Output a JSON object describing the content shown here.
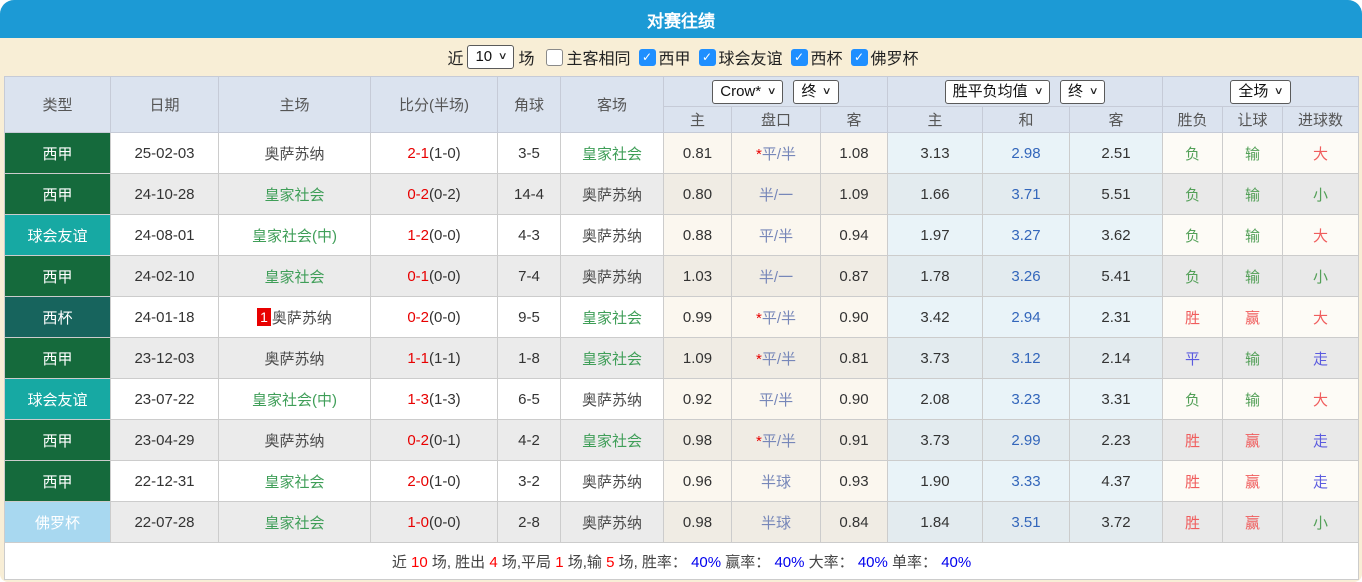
{
  "title": "对赛往绩",
  "filters": {
    "near_label": "近",
    "near_value": "10",
    "games_label": "场",
    "same_venue": {
      "label": "主客相同",
      "checked": false
    },
    "leagues": [
      {
        "label": "西甲",
        "checked": true
      },
      {
        "label": "球会友谊",
        "checked": true
      },
      {
        "label": "西杯",
        "checked": true
      },
      {
        "label": "佛罗杯",
        "checked": true
      }
    ]
  },
  "table": {
    "controls": {
      "odds_company": "Crow*",
      "odds_time": "终",
      "avg_label": "胜平负均值",
      "avg_time": "终",
      "scope": "全场"
    },
    "headers": {
      "type": "类型",
      "date": "日期",
      "home": "主场",
      "score": "比分(半场)",
      "corner": "角球",
      "away": "客场",
      "odds_home": "主",
      "odds_handicap": "盘口",
      "odds_away": "客",
      "avg_home": "主",
      "avg_draw": "和",
      "avg_away": "客",
      "result_wdl": "胜负",
      "result_handicap": "让球",
      "result_goals": "进球数"
    },
    "rows": [
      {
        "type": "西甲",
        "type_key": "liga",
        "date": "25-02-03",
        "home": "奥萨苏纳",
        "home_hl": false,
        "badge": "",
        "score_ft": "2-1",
        "score_ht": "(1-0)",
        "corner": "3-5",
        "away": "皇家社会",
        "away_hl": true,
        "o_home": "0.81",
        "h_star": "*",
        "handicap": "平/半",
        "o_away": "1.08",
        "a_home": "3.13",
        "a_draw": "2.98",
        "a_away": "2.51",
        "r1": "负",
        "r1c": "green",
        "r2": "输",
        "r2c": "green",
        "r3": "大",
        "r3c": "red"
      },
      {
        "type": "西甲",
        "type_key": "liga",
        "date": "24-10-28",
        "home": "皇家社会",
        "home_hl": true,
        "badge": "",
        "score_ft": "0-2",
        "score_ht": "(0-2)",
        "corner": "14-4",
        "away": "奥萨苏纳",
        "away_hl": false,
        "o_home": "0.80",
        "h_star": "",
        "handicap": "半/一",
        "o_away": "1.09",
        "a_home": "1.66",
        "a_draw": "3.71",
        "a_away": "5.51",
        "r1": "负",
        "r1c": "green",
        "r2": "输",
        "r2c": "green",
        "r3": "小",
        "r3c": "green"
      },
      {
        "type": "球会友谊",
        "type_key": "friendly",
        "date": "24-08-01",
        "home": "皇家社会(中)",
        "home_hl": true,
        "badge": "",
        "score_ft": "1-2",
        "score_ht": "(0-0)",
        "corner": "4-3",
        "away": "奥萨苏纳",
        "away_hl": false,
        "o_home": "0.88",
        "h_star": "",
        "handicap": "平/半",
        "o_away": "0.94",
        "a_home": "1.97",
        "a_draw": "3.27",
        "a_away": "3.62",
        "r1": "负",
        "r1c": "green",
        "r2": "输",
        "r2c": "green",
        "r3": "大",
        "r3c": "red"
      },
      {
        "type": "西甲",
        "type_key": "liga",
        "date": "24-02-10",
        "home": "皇家社会",
        "home_hl": true,
        "badge": "",
        "score_ft": "0-1",
        "score_ht": "(0-0)",
        "corner": "7-4",
        "away": "奥萨苏纳",
        "away_hl": false,
        "o_home": "1.03",
        "h_star": "",
        "handicap": "半/一",
        "o_away": "0.87",
        "a_home": "1.78",
        "a_draw": "3.26",
        "a_away": "5.41",
        "r1": "负",
        "r1c": "green",
        "r2": "输",
        "r2c": "green",
        "r3": "小",
        "r3c": "green"
      },
      {
        "type": "西杯",
        "type_key": "cup",
        "date": "24-01-18",
        "home": "奥萨苏纳",
        "home_hl": false,
        "badge": "1",
        "score_ft": "0-2",
        "score_ht": "(0-0)",
        "corner": "9-5",
        "away": "皇家社会",
        "away_hl": true,
        "o_home": "0.99",
        "h_star": "*",
        "handicap": "平/半",
        "o_away": "0.90",
        "a_home": "3.42",
        "a_draw": "2.94",
        "a_away": "2.31",
        "r1": "胜",
        "r1c": "red",
        "r2": "赢",
        "r2c": "red",
        "r3": "大",
        "r3c": "red"
      },
      {
        "type": "西甲",
        "type_key": "liga",
        "date": "23-12-03",
        "home": "奥萨苏纳",
        "home_hl": false,
        "badge": "",
        "score_ft": "1-1",
        "score_ht": "(1-1)",
        "corner": "1-8",
        "away": "皇家社会",
        "away_hl": true,
        "o_home": "1.09",
        "h_star": "*",
        "handicap": "平/半",
        "o_away": "0.81",
        "a_home": "3.73",
        "a_draw": "3.12",
        "a_away": "2.14",
        "r1": "平",
        "r1c": "blue",
        "r2": "输",
        "r2c": "green",
        "r3": "走",
        "r3c": "blue"
      },
      {
        "type": "球会友谊",
        "type_key": "friendly",
        "date": "23-07-22",
        "home": "皇家社会(中)",
        "home_hl": true,
        "badge": "",
        "score_ft": "1-3",
        "score_ht": "(1-3)",
        "corner": "6-5",
        "away": "奥萨苏纳",
        "away_hl": false,
        "o_home": "0.92",
        "h_star": "",
        "handicap": "平/半",
        "o_away": "0.90",
        "a_home": "2.08",
        "a_draw": "3.23",
        "a_away": "3.31",
        "r1": "负",
        "r1c": "green",
        "r2": "输",
        "r2c": "green",
        "r3": "大",
        "r3c": "red"
      },
      {
        "type": "西甲",
        "type_key": "liga",
        "date": "23-04-29",
        "home": "奥萨苏纳",
        "home_hl": false,
        "badge": "",
        "score_ft": "0-2",
        "score_ht": "(0-1)",
        "corner": "4-2",
        "away": "皇家社会",
        "away_hl": true,
        "o_home": "0.98",
        "h_star": "*",
        "handicap": "平/半",
        "o_away": "0.91",
        "a_home": "3.73",
        "a_draw": "2.99",
        "a_away": "2.23",
        "r1": "胜",
        "r1c": "red",
        "r2": "赢",
        "r2c": "red",
        "r3": "走",
        "r3c": "blue"
      },
      {
        "type": "西甲",
        "type_key": "liga",
        "date": "22-12-31",
        "home": "皇家社会",
        "home_hl": true,
        "badge": "",
        "score_ft": "2-0",
        "score_ht": "(1-0)",
        "corner": "3-2",
        "away": "奥萨苏纳",
        "away_hl": false,
        "o_home": "0.96",
        "h_star": "",
        "handicap": "半球",
        "o_away": "0.93",
        "a_home": "1.90",
        "a_draw": "3.33",
        "a_away": "4.37",
        "r1": "胜",
        "r1c": "red",
        "r2": "赢",
        "r2c": "red",
        "r3": "走",
        "r3c": "blue"
      },
      {
        "type": "佛罗杯",
        "type_key": "floro",
        "date": "22-07-28",
        "home": "皇家社会",
        "home_hl": true,
        "badge": "",
        "score_ft": "1-0",
        "score_ht": "(0-0)",
        "corner": "2-8",
        "away": "奥萨苏纳",
        "away_hl": false,
        "o_home": "0.98",
        "h_star": "",
        "handicap": "半球",
        "o_away": "0.84",
        "a_home": "1.84",
        "a_draw": "3.51",
        "a_away": "3.72",
        "r1": "胜",
        "r1c": "red",
        "r2": "赢",
        "r2c": "red",
        "r3": "小",
        "r3c": "green"
      }
    ]
  },
  "summary": {
    "segments": [
      {
        "text": "近 ",
        "color": "plain"
      },
      {
        "text": "10",
        "color": "red"
      },
      {
        "text": " 场, 胜出 ",
        "color": "plain"
      },
      {
        "text": "4",
        "color": "red"
      },
      {
        "text": " 场,平局 ",
        "color": "plain"
      },
      {
        "text": "1",
        "color": "red"
      },
      {
        "text": " 场,输 ",
        "color": "plain"
      },
      {
        "text": "5",
        "color": "red"
      },
      {
        "text": " 场, 胜率： ",
        "color": "plain"
      },
      {
        "text": "40%",
        "color": "blue"
      },
      {
        "text": " 赢率： ",
        "color": "plain"
      },
      {
        "text": "40%",
        "color": "blue"
      },
      {
        "text": " 大率： ",
        "color": "plain"
      },
      {
        "text": "40%",
        "color": "blue"
      },
      {
        "text": " 单率： ",
        "color": "plain"
      },
      {
        "text": "40%",
        "color": "blue"
      }
    ]
  },
  "colors": {
    "titlebar": "#1c9ad5",
    "frame_beige": "#f8eed6",
    "header_bg": "#dbe3ef",
    "liga_green": "#156a3c",
    "friendly_teal": "#17a9a3",
    "cup_dark_teal": "#17645d",
    "floro_light_blue": "#a8d8f0",
    "score_red": "#e80000",
    "team_green": "#3f9e58",
    "handicap_blue": "#7787b9",
    "avg_draw_blue": "#3366bb",
    "checkbox_blue": "#1f8fff"
  }
}
